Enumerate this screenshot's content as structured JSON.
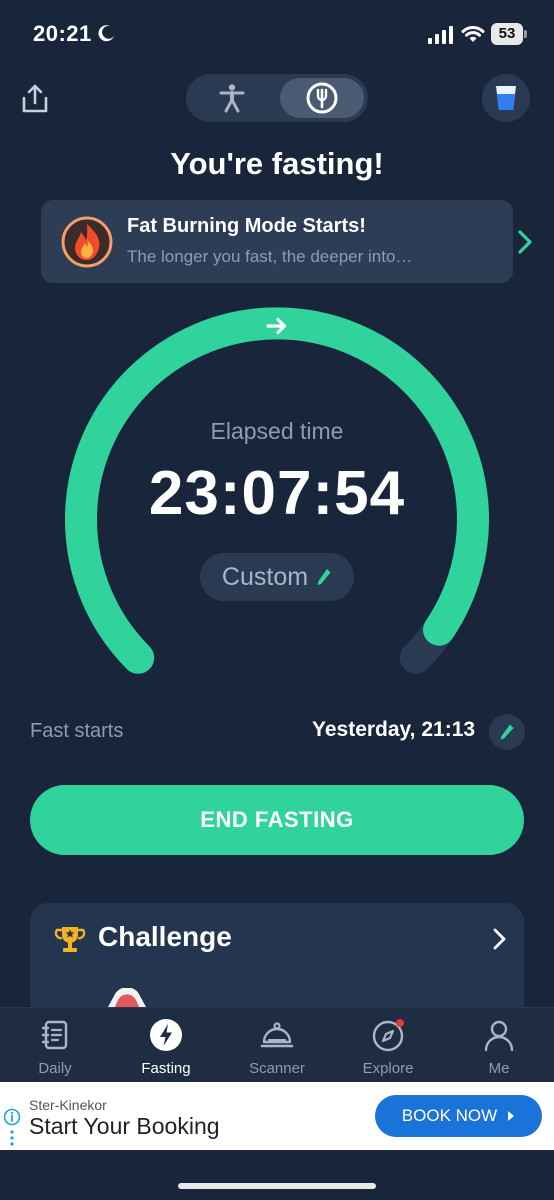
{
  "status_bar": {
    "time": "20:21",
    "battery": "53"
  },
  "page": {
    "title": "You're fasting!"
  },
  "banner": {
    "title": "Fat Burning Mode Starts!",
    "subtitle": "The longer you fast, the deeper into…"
  },
  "timer": {
    "label": "Elapsed time",
    "value": "23:07:54",
    "plan": "Custom",
    "progress_fraction": 0.96
  },
  "fast_start": {
    "label": "Fast starts",
    "value": "Yesterday, 21:13"
  },
  "end_button": {
    "label": "END FASTING"
  },
  "challenge": {
    "title": "Challenge"
  },
  "tabs": [
    {
      "label": "Daily",
      "icon": "journal-icon"
    },
    {
      "label": "Fasting",
      "icon": "lightning-icon",
      "active": true
    },
    {
      "label": "Scanner",
      "icon": "cloche-icon"
    },
    {
      "label": "Explore",
      "icon": "compass-icon",
      "badge": true
    },
    {
      "label": "Me",
      "icon": "person-icon"
    }
  ],
  "ad": {
    "sponsor": "Ster-Kinekor",
    "headline": "Start Your Booking",
    "cta": "BOOK NOW"
  },
  "colors": {
    "background": "#18253a",
    "accent": "#2fd39b",
    "card": "#2c3d55",
    "ad_button": "#1a73d8"
  }
}
